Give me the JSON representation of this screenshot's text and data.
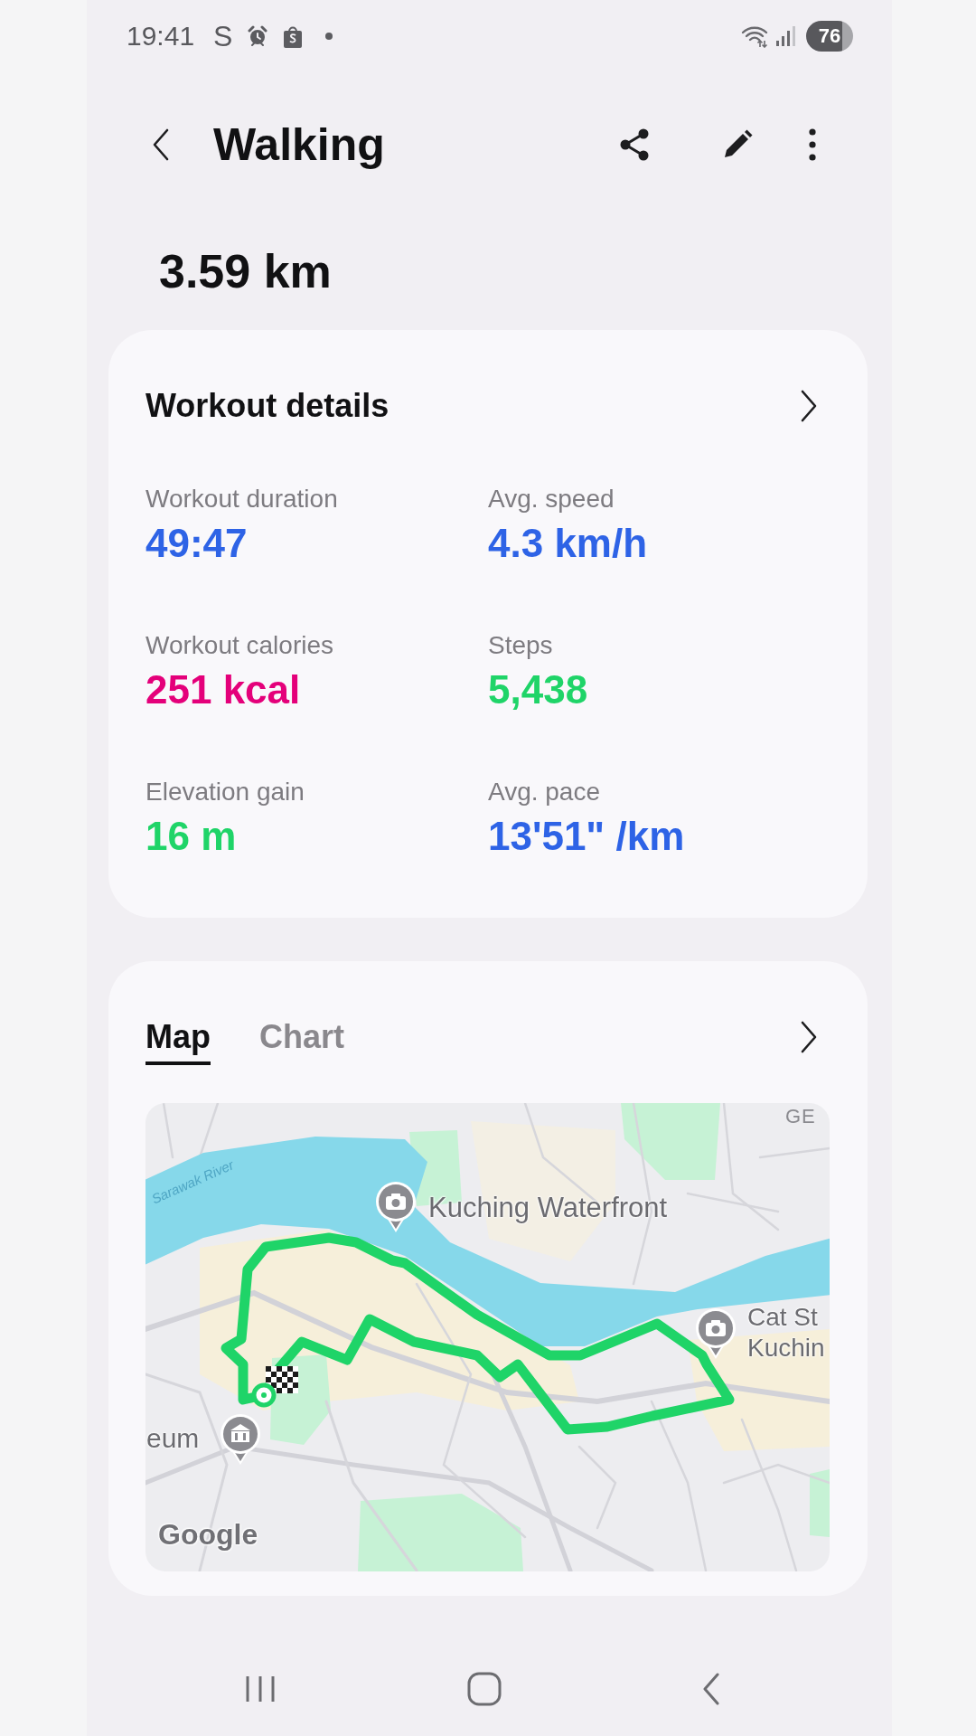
{
  "status_bar": {
    "time": "19:41",
    "notification_letter": "S",
    "battery": "76"
  },
  "header": {
    "title": "Walking"
  },
  "distance": "3.59 km",
  "details_card": {
    "title": "Workout details",
    "metrics": [
      {
        "label": "Workout duration",
        "value": "49:47",
        "color": "#2e63e6"
      },
      {
        "label": "Avg. speed",
        "value": "4.3 km/h",
        "color": "#2e63e6"
      },
      {
        "label": "Workout calories",
        "value": "251 kcal",
        "color": "#e4007a"
      },
      {
        "label": "Steps",
        "value": "5,438",
        "color": "#1fd468"
      },
      {
        "label": "Elevation gain",
        "value": "16 m",
        "color": "#1fd468"
      },
      {
        "label": "Avg. pace",
        "value": "13'51\" /km",
        "color": "#2e63e6"
      }
    ]
  },
  "map_card": {
    "tabs": [
      {
        "label": "Map",
        "selected": true
      },
      {
        "label": "Chart",
        "selected": false
      }
    ],
    "map": {
      "labels": [
        {
          "kind": "area",
          "lines": [
            "GE"
          ]
        },
        {
          "kind": "river",
          "lines": [
            "Sarawak River"
          ]
        },
        {
          "kind": "place",
          "lines": [
            "Kuching Waterfront"
          ]
        },
        {
          "kind": "place",
          "lines": [
            "Cat St",
            "Kuchin"
          ]
        },
        {
          "kind": "place",
          "lines": [
            "eum"
          ]
        }
      ],
      "attribution": "Google"
    }
  }
}
